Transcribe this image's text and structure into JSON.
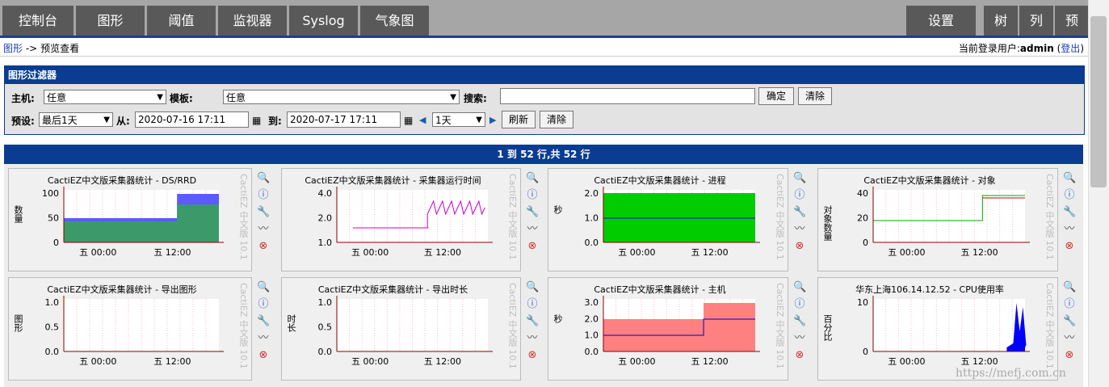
{
  "nav": {
    "tabs": [
      "控制台",
      "图形",
      "阈值",
      "监视器",
      "Syslog",
      "气象图"
    ],
    "settings": "设置",
    "right_tabs": [
      "树",
      "列",
      "预"
    ]
  },
  "breadcrumb": {
    "link": "图形",
    "sep": "->",
    "current": "预览查看",
    "login_label": "当前登录用户:",
    "user": "admin",
    "logout_open": "(",
    "logout": "登出",
    "logout_close": ")"
  },
  "filter": {
    "title": "图形过滤器",
    "host_label": "主机:",
    "host": "任意",
    "template_label": "模板:",
    "template": "任意",
    "search_label": "搜索:",
    "search_value": "",
    "ok": "确定",
    "clear": "清除",
    "preset_label": "预设:",
    "preset": "最后1天",
    "from_label": "从:",
    "from": "2020-07-16 17:11",
    "to_label": "到:",
    "to": "2020-07-17 17:11",
    "span": "1天",
    "refresh": "刷新",
    "clear2": "清除"
  },
  "pager": "1 到 52 行,共 52 行",
  "watermark": "CactiEZ 中文版 10.1",
  "footer_watermark": "https://mefj.com.cn",
  "graphs": [
    {
      "title": "CactiEZ中文版采集器统计 - DS/RRD",
      "ylabel": "数量",
      "yticks": [
        "100",
        "50",
        "0"
      ],
      "xticks": [
        "五 00:00",
        "五 12:00"
      ]
    },
    {
      "title": "CactiEZ中文版采集器统计 - 采集器运行时间",
      "ylabel": "",
      "yticks": [
        "4.0",
        "2.0",
        "1.0"
      ],
      "xticks": [
        "五 00:00",
        "五 12:00"
      ]
    },
    {
      "title": "CactiEZ中文版采集器统计 - 进程",
      "ylabel": "秒",
      "yticks": [
        "2.0",
        "1.0",
        "0.0"
      ],
      "xticks": [
        "五 00:00",
        "五 12:00"
      ]
    },
    {
      "title": "CactiEZ中文版采集器统计 - 对象",
      "ylabel": "对象数量",
      "yticks": [
        "40",
        "20",
        "0"
      ],
      "xticks": [
        "五 00:00",
        "五 12:00"
      ]
    },
    {
      "title": "CactiEZ中文版采集器统计 - 导出图形",
      "ylabel": "图形",
      "yticks": [
        "1.0",
        "0.5",
        "0.0"
      ],
      "xticks": [
        "五 00:00",
        "五 12:00"
      ]
    },
    {
      "title": "CactiEZ中文版采集器统计 - 导出时长",
      "ylabel": "时长",
      "yticks": [
        "1.0",
        "0.5",
        "0.0"
      ],
      "xticks": [
        "五 00:00",
        "五 12:00"
      ]
    },
    {
      "title": "CactiEZ中文版采集器统计 - 主机",
      "ylabel": "秒",
      "yticks": [
        "3.0",
        "2.0",
        "1.0",
        "0.0"
      ],
      "xticks": [
        "五 00:00",
        "五 12:00"
      ]
    },
    {
      "title": "华东上海106.14.12.52 - CPU使用率",
      "ylabel": "百分比",
      "yticks": [
        "10",
        "0"
      ],
      "xticks": [
        "五 00:00",
        "五 12:00"
      ]
    }
  ]
}
